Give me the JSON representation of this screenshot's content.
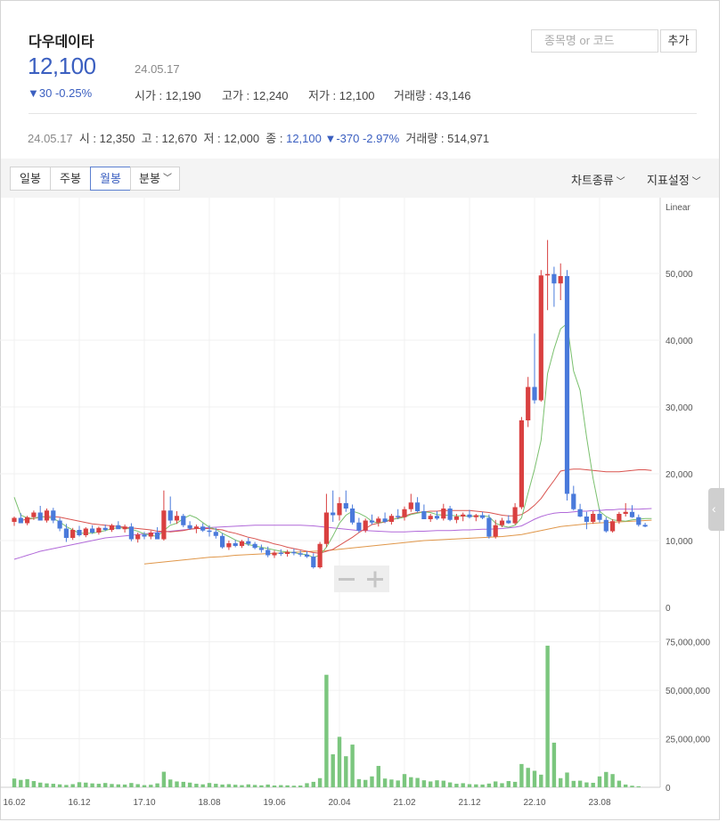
{
  "header": {
    "name": "다우데이타",
    "price": "12,100",
    "date": "24.05.17",
    "change": "▼30 -0.25%",
    "open_label": "시가",
    "open": "12,190",
    "high_label": "고가",
    "high": "12,240",
    "low_label": "저가",
    "low": "12,100",
    "volume_label": "거래량",
    "volume": "43,146"
  },
  "search": {
    "placeholder": "종목명 or 코드",
    "add_label": "추가"
  },
  "prev_period": {
    "date": "24.05.17",
    "o_label": "시",
    "o": "12,350",
    "h_label": "고",
    "h": "12,670",
    "l_label": "저",
    "l": "12,000",
    "c_label": "종",
    "c": "12,100",
    "change": "▼-370 -2.97%",
    "v_label": "거래량",
    "v": "514,971"
  },
  "toolbar": {
    "tabs": [
      "일봉",
      "주봉",
      "월봉",
      "분봉"
    ],
    "active_tab": "월봉",
    "chart_type": "차트종류",
    "indicator_settings": "지표설정"
  },
  "colors": {
    "up": "#d94040",
    "down": "#4a7adb",
    "volume": "#7bc67e",
    "ma5": "#7ac06e",
    "ma20": "#d9534f",
    "ma60": "#b169d9",
    "ma120": "#e0974a"
  },
  "chart_data": {
    "type": "candlestick",
    "scale_label": "Linear",
    "price_ylim": [
      0,
      60000
    ],
    "price_ticks": [
      "0",
      "10,000",
      "20,000",
      "30,000",
      "40,000",
      "50,000"
    ],
    "price_tick_values": [
      0,
      10000,
      20000,
      30000,
      40000,
      50000
    ],
    "volume_ylim": [
      0,
      90000000
    ],
    "volume_ticks": [
      "0",
      "25,000,000",
      "50,000,000",
      "75,000,000"
    ],
    "volume_tick_values": [
      0,
      25000000,
      50000000,
      75000000
    ],
    "x_tick_labels": [
      "16.02",
      "16.12",
      "17.10",
      "18.08",
      "19.06",
      "20.04",
      "21.02",
      "21.12",
      "22.10",
      "23.08"
    ],
    "x_tick_index": [
      0,
      10,
      20,
      30,
      40,
      50,
      60,
      70,
      80,
      90
    ],
    "candles": [
      [
        12800,
        13600,
        12200,
        13400
      ],
      [
        13400,
        14100,
        12900,
        12600
      ],
      [
        12600,
        13700,
        12300,
        13500
      ],
      [
        13500,
        14500,
        13100,
        14200
      ],
      [
        14200,
        15200,
        13600,
        13000
      ],
      [
        13000,
        14800,
        12700,
        14500
      ],
      [
        14500,
        14900,
        12600,
        13000
      ],
      [
        13000,
        13400,
        11400,
        11800
      ],
      [
        11800,
        12500,
        9800,
        10400
      ],
      [
        10400,
        11900,
        10100,
        11600
      ],
      [
        11600,
        12200,
        10600,
        10800
      ],
      [
        10800,
        12000,
        10500,
        11800
      ],
      [
        11800,
        12300,
        11000,
        11200
      ],
      [
        11200,
        12100,
        10900,
        11900
      ],
      [
        11900,
        12400,
        11400,
        11600
      ],
      [
        11600,
        12500,
        11300,
        12300
      ],
      [
        12300,
        12900,
        11800,
        11700
      ],
      [
        11700,
        12400,
        11200,
        12100
      ],
      [
        12100,
        12600,
        9900,
        10200
      ],
      [
        10200,
        11200,
        9700,
        10900
      ],
      [
        10900,
        11300,
        10200,
        10600
      ],
      [
        10600,
        11500,
        10200,
        11200
      ],
      [
        11200,
        12000,
        10700,
        10200
      ],
      [
        10200,
        17500,
        10000,
        14500
      ],
      [
        14500,
        16600,
        12500,
        13000
      ],
      [
        13000,
        14400,
        12500,
        13700
      ],
      [
        13700,
        14000,
        12000,
        12300
      ],
      [
        12300,
        12900,
        11600,
        11800
      ],
      [
        11800,
        12400,
        11100,
        12100
      ],
      [
        12100,
        12600,
        11300,
        11500
      ],
      [
        11500,
        12300,
        10600,
        11300
      ],
      [
        11300,
        11900,
        10300,
        10700
      ],
      [
        10700,
        11100,
        8800,
        9000
      ],
      [
        9000,
        10000,
        8600,
        9600
      ],
      [
        9600,
        10100,
        9000,
        9200
      ],
      [
        9200,
        10100,
        8900,
        9900
      ],
      [
        9900,
        10400,
        9200,
        9500
      ],
      [
        9500,
        9800,
        8700,
        8900
      ],
      [
        8900,
        9400,
        8200,
        8600
      ],
      [
        8600,
        9100,
        7500,
        7800
      ],
      [
        7800,
        8500,
        7400,
        8200
      ],
      [
        8200,
        8700,
        7700,
        8000
      ],
      [
        8000,
        8600,
        7600,
        8300
      ],
      [
        8300,
        8800,
        7800,
        8100
      ],
      [
        8100,
        8500,
        7600,
        7900
      ],
      [
        7900,
        8400,
        7400,
        7600
      ],
      [
        7600,
        8100,
        5800,
        6000
      ],
      [
        6000,
        9800,
        5800,
        9500
      ],
      [
        9500,
        17000,
        9000,
        14200
      ],
      [
        14200,
        17500,
        12800,
        13800
      ],
      [
        13800,
        16500,
        13000,
        15600
      ],
      [
        15600,
        17500,
        14300,
        14800
      ],
      [
        14800,
        15400,
        12400,
        12700
      ],
      [
        12700,
        13400,
        11200,
        11500
      ],
      [
        11500,
        13300,
        11200,
        13000
      ],
      [
        13000,
        13900,
        12400,
        12700
      ],
      [
        12700,
        13600,
        12100,
        13300
      ],
      [
        13300,
        14200,
        12600,
        12800
      ],
      [
        12800,
        14000,
        12400,
        13700
      ],
      [
        13700,
        14700,
        13200,
        13500
      ],
      [
        13500,
        15100,
        13000,
        14700
      ],
      [
        14700,
        17000,
        14300,
        15700
      ],
      [
        15700,
        16500,
        14200,
        14400
      ],
      [
        14400,
        15400,
        13500,
        13200
      ],
      [
        13200,
        14000,
        12800,
        13700
      ],
      [
        13700,
        14400,
        13100,
        13300
      ],
      [
        13300,
        15500,
        13000,
        14800
      ],
      [
        14800,
        15200,
        12900,
        13100
      ],
      [
        13100,
        14000,
        12600,
        13600
      ],
      [
        13600,
        14200,
        12900,
        13900
      ],
      [
        13900,
        14600,
        13300,
        13500
      ],
      [
        13500,
        14000,
        12900,
        13800
      ],
      [
        13800,
        14300,
        13200,
        13400
      ],
      [
        13400,
        13900,
        10300,
        10600
      ],
      [
        10600,
        13100,
        10300,
        12300
      ],
      [
        12300,
        13400,
        12000,
        13000
      ],
      [
        13000,
        13800,
        12500,
        12600
      ],
      [
        12600,
        15600,
        12400,
        15000
      ],
      [
        15000,
        28500,
        14700,
        28000
      ],
      [
        28000,
        34500,
        27000,
        33000
      ],
      [
        33000,
        41000,
        30500,
        31000
      ],
      [
        31000,
        50500,
        30800,
        49700
      ],
      [
        49700,
        55000,
        44500,
        49900
      ],
      [
        49900,
        51000,
        45000,
        48500
      ],
      [
        48500,
        51500,
        46000,
        49600
      ],
      [
        49600,
        50500,
        16000,
        17000
      ],
      [
        17000,
        18200,
        14500,
        14700
      ],
      [
        14700,
        15500,
        13500,
        13600
      ],
      [
        13600,
        14300,
        11700,
        12800
      ],
      [
        12800,
        14400,
        12500,
        14000
      ],
      [
        14000,
        14700,
        12700,
        13100
      ],
      [
        13100,
        13500,
        11200,
        11400
      ],
      [
        11400,
        13200,
        11200,
        12900
      ],
      [
        12900,
        14300,
        12500,
        14000
      ],
      [
        14000,
        15600,
        13600,
        14300
      ],
      [
        14300,
        15300,
        13400,
        13500
      ],
      [
        13500,
        13900,
        12100,
        12350
      ],
      [
        12350,
        12670,
        12000,
        12100
      ]
    ],
    "volume_values": [
      4500000,
      3800000,
      4200000,
      3200000,
      2400000,
      2000000,
      1800000,
      1500000,
      1200000,
      1600000,
      2600000,
      2400000,
      2000000,
      1800000,
      2200000,
      1700000,
      1500000,
      1400000,
      2200000,
      1600000,
      1100000,
      1300000,
      2000000,
      8000000,
      4000000,
      3000000,
      2800000,
      2400000,
      1800000,
      1500000,
      2200000,
      1800000,
      1400000,
      1600000,
      1300000,
      1100000,
      1500000,
      1200000,
      1000000,
      1400000,
      900000,
      1100000,
      1000000,
      800000,
      900000,
      2100000,
      2800000,
      4700000,
      58000000,
      17000000,
      26000000,
      16000000,
      22000000,
      4200000,
      3800000,
      5600000,
      11000000,
      4500000,
      4000000,
      3500000,
      6800000,
      5200000,
      4800000,
      3600000,
      3000000,
      3600000,
      3400000,
      2500000,
      1800000,
      2100000,
      1600000,
      1500000,
      1400000,
      1900000,
      3000000,
      2100000,
      3200000,
      2800000,
      12000000,
      10000000,
      8500000,
      6500000,
      73000000,
      23000000,
      4700000,
      7600000,
      3300000,
      3400000,
      2500000,
      2300000,
      5600000,
      7900000,
      6800000,
      3400000,
      1400000,
      800000,
      500000
    ],
    "ma5": [
      16500,
      13800,
      13400,
      13300,
      13600,
      13500,
      13300,
      12800,
      12100,
      11600,
      11100,
      11100,
      11100,
      11300,
      11500,
      11800,
      11900,
      11900,
      11700,
      11400,
      11000,
      10800,
      10600,
      11500,
      12300,
      12600,
      13300,
      13800,
      13400,
      12700,
      12000,
      11700,
      11100,
      10600,
      10100,
      9700,
      9400,
      9200,
      9000,
      8800,
      8600,
      8400,
      8300,
      8200,
      8000,
      7900,
      7500,
      7800,
      9000,
      10700,
      12600,
      13800,
      14400,
      14100,
      13600,
      12900,
      12600,
      12900,
      13200,
      13300,
      13500,
      13900,
      14100,
      14300,
      14200,
      13900,
      13800,
      13800,
      13700,
      13700,
      13600,
      13700,
      13700,
      13600,
      12600,
      12200,
      12000,
      12300,
      13400,
      17100,
      20700,
      25000,
      35000,
      38700,
      41700,
      42500,
      35400,
      32500,
      25500,
      19300,
      14400,
      13600,
      13100,
      13000,
      12900,
      13100,
      13200,
      13300,
      13300
    ],
    "ma20": [
      null,
      13000,
      13200,
      13300,
      13500,
      13600,
      13600,
      13500,
      13300,
      13100,
      12900,
      12700,
      12500,
      12400,
      12300,
      12200,
      12100,
      12000,
      11900,
      11800,
      11700,
      11600,
      11400,
      11400,
      11300,
      11400,
      11500,
      11700,
      11800,
      11800,
      11800,
      11700,
      11600,
      11300,
      11100,
      10800,
      10500,
      10300,
      10000,
      9800,
      9500,
      9300,
      9000,
      8800,
      8600,
      8400,
      8200,
      8100,
      8400,
      8700,
      9300,
      9900,
      10500,
      11200,
      11800,
      12400,
      12600,
      12800,
      13100,
      13400,
      13700,
      14000,
      14200,
      14300,
      14400,
      14400,
      14500,
      14500,
      14500,
      14500,
      14500,
      14400,
      14300,
      14200,
      14000,
      13800,
      13700,
      13700,
      13900,
      14500,
      15300,
      16300,
      17700,
      19000,
      20400,
      20600,
      20700,
      20700,
      20600,
      20500,
      20400,
      20300,
      20300,
      20300,
      20400,
      20500,
      20600,
      20600,
      20500
    ],
    "ma60": [
      7200,
      7500,
      7800,
      8100,
      8400,
      8600,
      8800,
      9000,
      9200,
      9400,
      9600,
      9800,
      10000,
      10200,
      10400,
      10500,
      10600,
      10700,
      10800,
      10900,
      11000,
      11100,
      11200,
      11300,
      11400,
      11500,
      11600,
      11700,
      11800,
      11900,
      11950,
      12000,
      12050,
      12100,
      12150,
      12200,
      12250,
      12300,
      12300,
      12300,
      12300,
      12300,
      12300,
      12300,
      12300,
      12250,
      12200,
      12100,
      12000,
      11900,
      11800,
      11700,
      11600,
      11500,
      11500,
      11450,
      11400,
      11350,
      11300,
      11300,
      11300,
      11350,
      11400,
      11400,
      11450,
      11500,
      11500,
      11500,
      11550,
      11600,
      11600,
      11650,
      11700,
      11700,
      11750,
      11800,
      11900,
      12000,
      12200,
      12700,
      13200,
      13600,
      13900,
      14100,
      14200,
      14200,
      14300,
      14400,
      14400,
      14500,
      14500,
      14600,
      14600,
      14700,
      14700,
      14700,
      14700,
      14750,
      14800
    ],
    "ma120": [
      null,
      null,
      null,
      null,
      null,
      null,
      null,
      null,
      null,
      null,
      null,
      null,
      null,
      null,
      null,
      null,
      null,
      null,
      null,
      null,
      6500,
      6600,
      6700,
      6800,
      6900,
      7000,
      7100,
      7200,
      7300,
      7400,
      7500,
      7550,
      7600,
      7700,
      7800,
      7850,
      7900,
      7950,
      8000,
      8050,
      8100,
      8150,
      8200,
      8250,
      8300,
      8350,
      8400,
      8450,
      8500,
      8600,
      8700,
      8800,
      8900,
      9000,
      9100,
      9200,
      9300,
      9400,
      9500,
      9600,
      9700,
      9800,
      9900,
      10000,
      10050,
      10100,
      10150,
      10200,
      10250,
      10300,
      10350,
      10400,
      10450,
      10500,
      10550,
      10600,
      10700,
      10800,
      10900,
      11100,
      11300,
      11500,
      11700,
      11900,
      12100,
      12200,
      12300,
      12400,
      12500,
      12600,
      12650,
      12700,
      12750,
      12800,
      12850,
      12900,
      12950,
      13000,
      13050
    ]
  }
}
